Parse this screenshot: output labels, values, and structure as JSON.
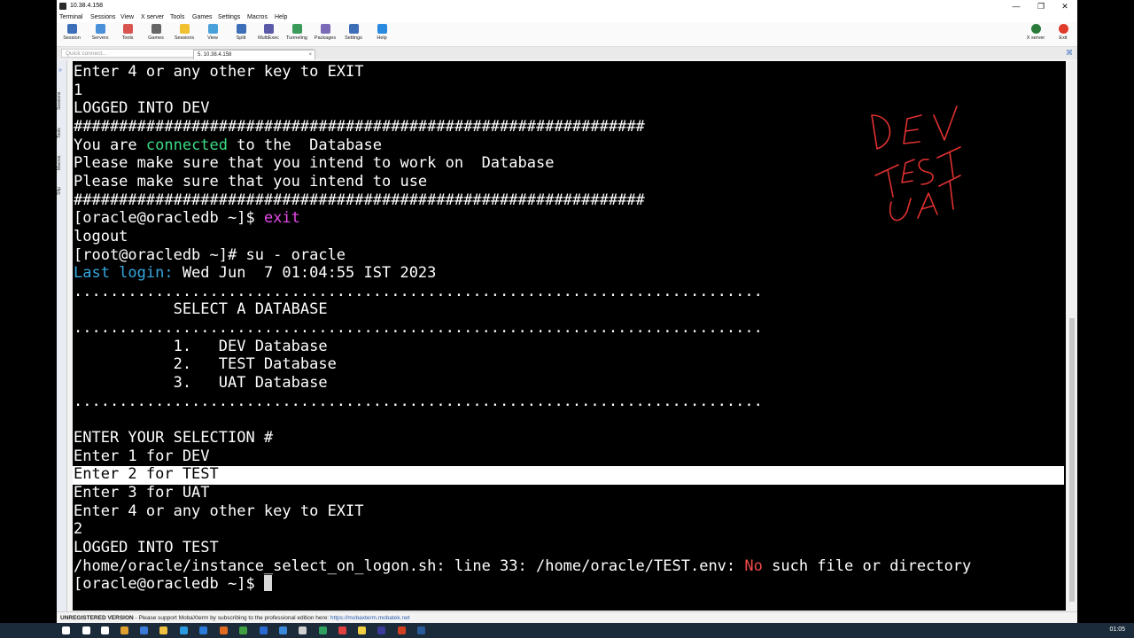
{
  "window": {
    "title": "10.38.4.158",
    "controls": [
      "—",
      "❐",
      "✕"
    ]
  },
  "menubar": {
    "items": [
      "Terminal",
      "Sessions",
      "View",
      "X server",
      "Tools",
      "Games",
      "Settings",
      "Macros",
      "Help"
    ]
  },
  "toolbar": {
    "buttons": [
      {
        "label": "Session",
        "icon": "session-icon",
        "color": "#3d6fb8"
      },
      {
        "label": "Servers",
        "icon": "servers-icon",
        "color": "#4a90d9"
      },
      {
        "label": "Tools",
        "icon": "tools-icon",
        "color": "#d9534f"
      },
      {
        "label": "Games",
        "icon": "games-icon",
        "color": "#666666"
      },
      {
        "label": "Sessions",
        "icon": "star-icon",
        "color": "#f0c030"
      },
      {
        "label": "View",
        "icon": "view-icon",
        "color": "#4aa0d9"
      },
      {
        "label": "Split",
        "icon": "split-icon",
        "color": "#3d6fb8"
      },
      {
        "label": "MultiExec",
        "icon": "multiexec-icon",
        "color": "#5a5aa8"
      },
      {
        "label": "Tunneling",
        "icon": "tunneling-icon",
        "color": "#3a9a5a"
      },
      {
        "label": "Packages",
        "icon": "packages-icon",
        "color": "#7a6ab8"
      },
      {
        "label": "Settings",
        "icon": "gear-icon",
        "color": "#3d6fb8"
      },
      {
        "label": "Help",
        "icon": "help-icon",
        "color": "#2a8ae0"
      }
    ],
    "right": [
      {
        "label": "X server",
        "icon": "x-server-icon",
        "color": "#2a7a3a"
      },
      {
        "label": "Exit",
        "icon": "power-icon",
        "color": "#e03a2a"
      }
    ]
  },
  "quick_connect": {
    "placeholder": "Quick connect..."
  },
  "tab": {
    "label": "5. 10.38.4.158",
    "close": "×"
  },
  "sidebar": {
    "labels": [
      "Sessions",
      "Tools",
      "Macros",
      "Sftp"
    ]
  },
  "terminal": {
    "lines": [
      [
        {
          "t": "Enter 4 or any other key to EXIT"
        }
      ],
      [
        {
          "t": "1"
        }
      ],
      [
        {
          "t": "LOGGED INTO DEV"
        }
      ],
      [
        {
          "t": "###############################################################"
        }
      ],
      [
        {
          "t": "You are "
        },
        {
          "t": "connected",
          "c": "green"
        },
        {
          "t": " to the  Database"
        }
      ],
      [
        {
          "t": "Please make sure that you intend to work on  Database"
        }
      ],
      [
        {
          "t": "Please make sure that you intend to use"
        }
      ],
      [
        {
          "t": "###############################################################"
        }
      ],
      [
        {
          "t": "[oracle@oracledb ~]$ "
        },
        {
          "t": "exit",
          "c": "magenta"
        }
      ],
      [
        {
          "t": "logout"
        }
      ],
      [
        {
          "t": "[root@oracledb ~]# su - oracle"
        }
      ],
      [
        {
          "t": "Last login:",
          "c": "cyan"
        },
        {
          "t": " Wed Jun  7 01:04:55 IST 2023"
        }
      ],
      [
        {
          "t": "............................................................................"
        }
      ],
      [
        {
          "t": "           SELECT A DATABASE"
        }
      ],
      [
        {
          "t": "............................................................................"
        }
      ],
      [
        {
          "t": "           1.   DEV Database"
        }
      ],
      [
        {
          "t": "           2.   TEST Database"
        }
      ],
      [
        {
          "t": "           3.   UAT Database"
        }
      ],
      [
        {
          "t": "............................................................................"
        }
      ],
      [
        {
          "t": ""
        }
      ],
      [
        {
          "t": "ENTER YOUR SELECTION #"
        }
      ],
      [
        {
          "t": "Enter 1 for DEV"
        }
      ],
      [
        {
          "t": "Enter 2 for TEST",
          "c": "hl-text"
        }
      ],
      [
        {
          "t": "Enter 3 for UAT"
        }
      ],
      [
        {
          "t": "Enter 4 or any other key to EXIT"
        }
      ],
      [
        {
          "t": "2"
        }
      ],
      [
        {
          "t": "LOGGED INTO TEST"
        }
      ],
      [
        {
          "t": "/home/oracle/instance_select_on_logon.sh: line 33: /home/oracle/TEST.env: "
        },
        {
          "t": "No",
          "c": "red"
        },
        {
          "t": " such file or directory"
        }
      ],
      [
        {
          "t": "[oracle@oracledb ~]$ "
        },
        {
          "cursor": true
        }
      ]
    ]
  },
  "statusbar": {
    "prefix": "UNREGISTERED VERSION",
    "message": "  -  Please support MobaXterm by subscribing to the professional edition here: ",
    "link": "https://mobaxterm.mobatek.net"
  },
  "annotation": {
    "words": [
      "DEV",
      "TEST",
      "UAT"
    ],
    "color": "#e03030"
  },
  "taskbar": {
    "clock": "01:05",
    "icons": [
      "windows-icon",
      "search-icon",
      "task-view-icon",
      "app-icon",
      "app-icon",
      "folder-icon",
      "edge-icon",
      "ie-icon",
      "firefox-icon",
      "chrome-icon",
      "outlook-icon",
      "app-icon",
      "app-icon",
      "app-icon",
      "app-icon",
      "app-icon",
      "app-icon",
      "office-icon",
      "mobaxterm-icon"
    ],
    "colors": [
      "#ffffff",
      "#ffffff",
      "#ffffff",
      "#e0a030",
      "#3a7ad9",
      "#f0c040",
      "#2a9ae0",
      "#2a7ad9",
      "#e06a20",
      "#40a040",
      "#2a6ad0",
      "#3a8ad9",
      "#d0d0d0",
      "#30a060",
      "#e04040",
      "#f0d040",
      "#3a3a9a",
      "#d04020",
      "#2a5a9a"
    ]
  }
}
